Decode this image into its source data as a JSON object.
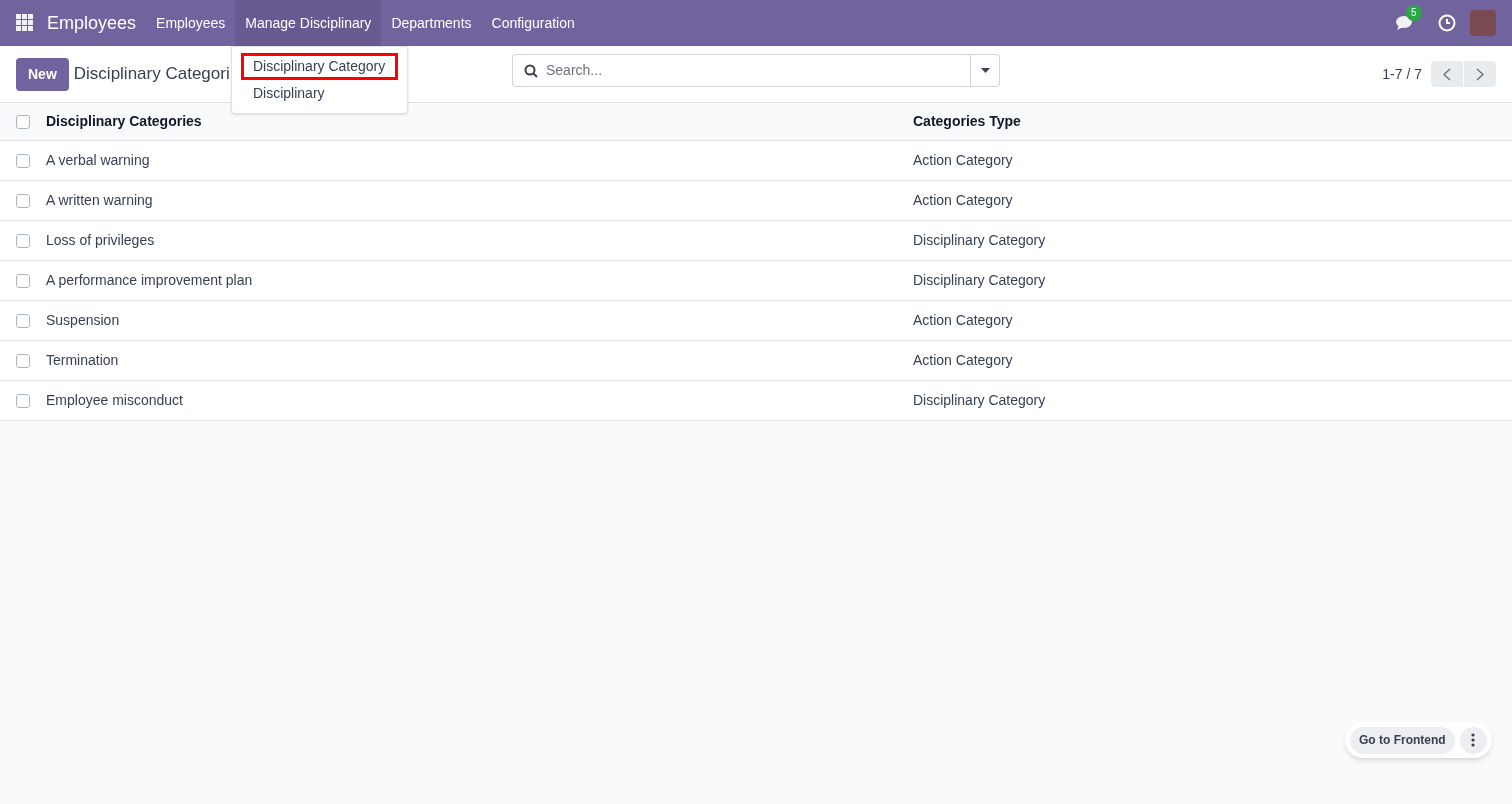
{
  "navbar": {
    "app_name": "Employees",
    "menus": [
      {
        "label": "Employees",
        "selected": false
      },
      {
        "label": "Manage Disciplinary",
        "selected": true
      },
      {
        "label": "Departments",
        "selected": false
      },
      {
        "label": "Configuration",
        "selected": false
      }
    ],
    "message_count": "5"
  },
  "dropdown": {
    "items": [
      {
        "label": "Disciplinary Category",
        "highlighted": true
      },
      {
        "label": "Disciplinary",
        "highlighted": false
      }
    ]
  },
  "control_panel": {
    "new_button": "New",
    "title": "Disciplinary Categori",
    "search": {
      "placeholder": "Search..."
    },
    "pager": "1-7 / 7"
  },
  "table": {
    "select_all_checked": false,
    "columns": [
      "Disciplinary Categories",
      "Categories Type"
    ],
    "rows": [
      {
        "name": "A verbal warning",
        "type": "Action Category",
        "checked": false
      },
      {
        "name": "A written warning",
        "type": "Action Category",
        "checked": false
      },
      {
        "name": "Loss of privileges",
        "type": "Disciplinary Category",
        "checked": false
      },
      {
        "name": "A performance improvement plan",
        "type": "Disciplinary Category",
        "checked": false
      },
      {
        "name": "Suspension",
        "type": "Action Category",
        "checked": false
      },
      {
        "name": "Termination",
        "type": "Action Category",
        "checked": false
      },
      {
        "name": "Employee misconduct",
        "type": "Disciplinary Category",
        "checked": false
      }
    ]
  },
  "floating": {
    "button": "Go to Frontend"
  }
}
